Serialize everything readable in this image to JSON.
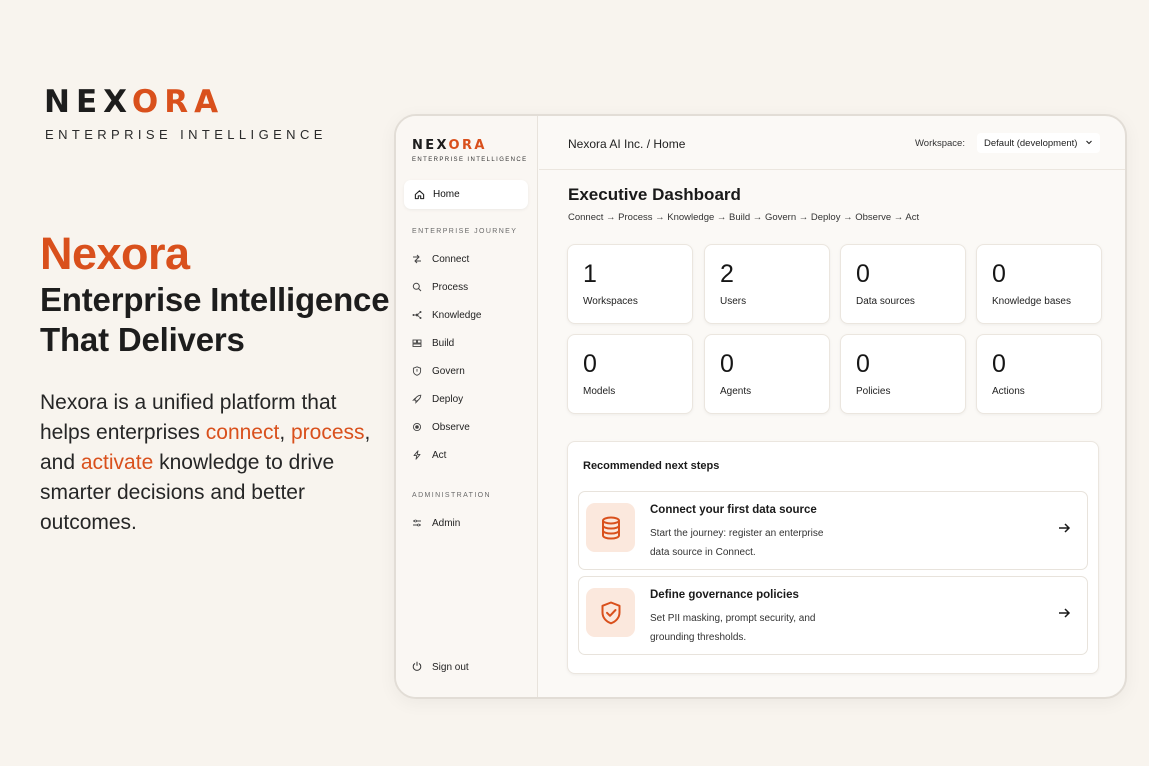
{
  "brand": {
    "logo_dark": "NEX",
    "logo_accent": "ORA",
    "tagline": "ENTERPRISE INTELLIGENCE"
  },
  "hero": {
    "name": "Nexora",
    "line1": "Enterprise Intelligence",
    "line2": "That Delivers",
    "body_part1": "Nexora is a unified platform that helps enterprises ",
    "kw_connect": "connect",
    "sep1": ", ",
    "kw_process": "process",
    "sep2": ", and ",
    "kw_activate": "activate",
    "body_part2": " knowledge to drive smarter decisions and better outcomes."
  },
  "sidebar": {
    "logo_dark": "NEX",
    "logo_accent": "ORA",
    "tagline": "ENTERPRISE INTELLIGENCE",
    "home_label": "Home",
    "journey_heading": "ENTERPRISE JOURNEY",
    "journey_items": [
      {
        "label": "Connect",
        "icon": "connect-icon"
      },
      {
        "label": "Process",
        "icon": "search-icon"
      },
      {
        "label": "Knowledge",
        "icon": "network-icon"
      },
      {
        "label": "Build",
        "icon": "blocks-icon"
      },
      {
        "label": "Govern",
        "icon": "shield-icon"
      },
      {
        "label": "Deploy",
        "icon": "rocket-icon"
      },
      {
        "label": "Observe",
        "icon": "eye-icon"
      },
      {
        "label": "Act",
        "icon": "bolt-icon"
      }
    ],
    "admin_heading": "ADMINISTRATION",
    "admin_label": "Admin",
    "signout_label": "Sign out"
  },
  "topbar": {
    "breadcrumb": "Nexora AI Inc. / Home",
    "workspace_label": "Workspace:",
    "workspace_value": "Default (development)"
  },
  "dashboard": {
    "title": "Executive Dashboard",
    "journey": "Connect → Process → Knowledge → Build → Govern → Deploy → Observe → Act",
    "stats": [
      {
        "value": "1",
        "label": "Workspaces"
      },
      {
        "value": "2",
        "label": "Users"
      },
      {
        "value": "0",
        "label": "Data sources"
      },
      {
        "value": "0",
        "label": "Knowledge bases"
      },
      {
        "value": "0",
        "label": "Models"
      },
      {
        "value": "0",
        "label": "Agents"
      },
      {
        "value": "0",
        "label": "Policies"
      },
      {
        "value": "0",
        "label": "Actions"
      }
    ]
  },
  "next_steps": {
    "title": "Recommended next steps",
    "items": [
      {
        "title": "Connect your first data source",
        "desc": "Start the journey: register an enterprise data source in Connect.",
        "icon": "database-icon"
      },
      {
        "title": "Define governance policies",
        "desc": "Set PII masking, prompt security, and grounding thresholds.",
        "icon": "shield-check-icon"
      }
    ]
  },
  "colors": {
    "accent": "#d9501c",
    "background": "#f8f4ee",
    "icon_tile": "#fbe8dd"
  }
}
